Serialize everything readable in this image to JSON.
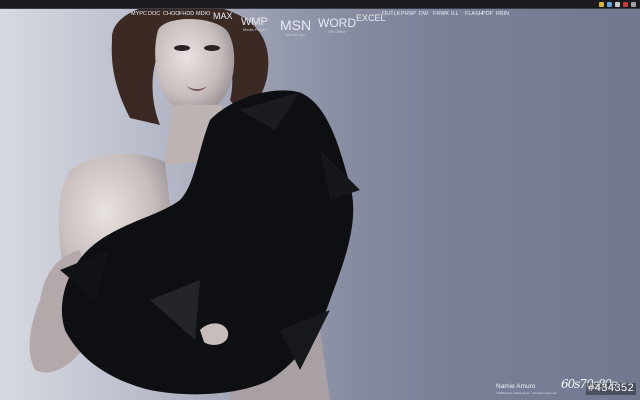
{
  "launchers_small_left": [
    "MYPC",
    "DOC",
    "CHOO",
    "FHDD",
    "MDIO"
  ],
  "launchers_big": [
    {
      "label": "MAX",
      "sub": ""
    },
    {
      "label": "WMP",
      "sub": "Media Player"
    },
    {
      "label": "MSN",
      "sub": "Messenger"
    },
    {
      "label": "WORD",
      "sub": "MS Office"
    },
    {
      "label": "EXCEL",
      "sub": ""
    }
  ],
  "launchers_small_right": [
    "OUTLK",
    "PHSP",
    "DW",
    "FRWK",
    "ILL",
    "FLASH",
    "PDF",
    "RBIN"
  ],
  "tray_colors": [
    "#d8b040",
    "#6aa0d8",
    "#c8c8c8",
    "#c04040",
    "#a0a0a0"
  ],
  "signature": {
    "name": "Namie Amuro",
    "fine_print": "©2008 avex marketing inc. All rights reserved."
  },
  "logo": "60s70s80s",
  "watermark": "#434352"
}
